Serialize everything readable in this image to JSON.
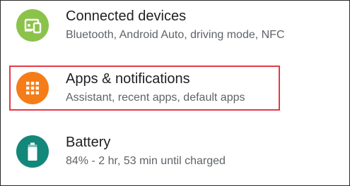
{
  "settings": {
    "items": [
      {
        "title": "Connected devices",
        "subtitle": "Bluetooth, Android Auto, driving mode, NFC",
        "icon": "connected-devices-icon",
        "color": "#8bc34a"
      },
      {
        "title": "Apps & notifications",
        "subtitle": "Assistant, recent apps, default apps",
        "icon": "apps-grid-icon",
        "color": "#f57c17"
      },
      {
        "title": "Battery",
        "subtitle": "84% - 2 hr, 53 min until charged",
        "icon": "battery-icon",
        "color": "#13877a",
        "battery_level_percent": 84
      }
    ]
  },
  "highlight": {
    "target": "Apps & notifications",
    "color": "#e53946"
  }
}
